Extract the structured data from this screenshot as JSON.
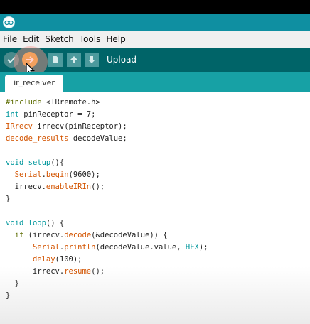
{
  "menu": [
    "File",
    "Edit",
    "Sketch",
    "Tools",
    "Help"
  ],
  "toolbar": {
    "hover_label": "Upload",
    "buttons": [
      "verify",
      "upload",
      "new",
      "open",
      "save"
    ]
  },
  "tab": {
    "label": "ir_receiver"
  },
  "colors": {
    "titlebar": "#0f8fa1",
    "toolbar": "#006468",
    "tabstrip": "#17a1a5",
    "upload_button": "#e8a83a",
    "keyword_type": "#00979c",
    "keyword_function": "#d35400"
  },
  "code": [
    [
      {
        "t": "#include ",
        "c": "kw-pre"
      },
      {
        "t": "<IRremote.h>",
        "c": ""
      }
    ],
    [
      {
        "t": "int",
        "c": "kw-type"
      },
      {
        "t": " pinReceptor = 7;",
        "c": ""
      }
    ],
    [
      {
        "t": "IRrecv",
        "c": "kw-class"
      },
      {
        "t": " irrecv(pinReceptor);",
        "c": ""
      }
    ],
    [
      {
        "t": "decode_results",
        "c": "kw-class"
      },
      {
        "t": " decodeValue;",
        "c": ""
      }
    ],
    [],
    [
      {
        "t": "void",
        "c": "kw-type"
      },
      {
        "t": " ",
        "c": ""
      },
      {
        "t": "setup",
        "c": "kw-type"
      },
      {
        "t": "(){",
        "c": ""
      }
    ],
    [
      {
        "t": "  ",
        "c": ""
      },
      {
        "t": "Serial",
        "c": "kw-class"
      },
      {
        "t": ".",
        "c": ""
      },
      {
        "t": "begin",
        "c": "kw-fn"
      },
      {
        "t": "(9600);",
        "c": ""
      }
    ],
    [
      {
        "t": "  irrecv.",
        "c": ""
      },
      {
        "t": "enableIRIn",
        "c": "kw-fn"
      },
      {
        "t": "();",
        "c": ""
      }
    ],
    [
      {
        "t": "}",
        "c": ""
      }
    ],
    [],
    [
      {
        "t": "void",
        "c": "kw-type"
      },
      {
        "t": " ",
        "c": ""
      },
      {
        "t": "loop",
        "c": "kw-type"
      },
      {
        "t": "() {",
        "c": ""
      }
    ],
    [
      {
        "t": "  ",
        "c": ""
      },
      {
        "t": "if",
        "c": "kw-pre"
      },
      {
        "t": " (irrecv.",
        "c": ""
      },
      {
        "t": "decode",
        "c": "kw-fn"
      },
      {
        "t": "(&decodeValue)) {",
        "c": ""
      }
    ],
    [
      {
        "t": "      ",
        "c": ""
      },
      {
        "t": "Serial",
        "c": "kw-class"
      },
      {
        "t": ".",
        "c": ""
      },
      {
        "t": "println",
        "c": "kw-fn"
      },
      {
        "t": "(decodeValue.value, ",
        "c": ""
      },
      {
        "t": "HEX",
        "c": "kw-const"
      },
      {
        "t": ");",
        "c": ""
      }
    ],
    [
      {
        "t": "      ",
        "c": ""
      },
      {
        "t": "delay",
        "c": "kw-fn"
      },
      {
        "t": "(100);",
        "c": ""
      }
    ],
    [
      {
        "t": "      irrecv.",
        "c": ""
      },
      {
        "t": "resume",
        "c": "kw-fn"
      },
      {
        "t": "();",
        "c": ""
      }
    ],
    [
      {
        "t": "  }",
        "c": ""
      }
    ],
    [
      {
        "t": "}",
        "c": ""
      }
    ]
  ]
}
